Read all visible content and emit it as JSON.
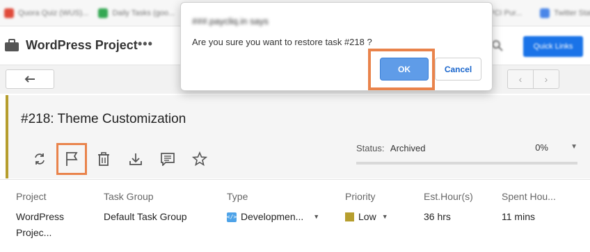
{
  "browser": {
    "bookmarks": [
      {
        "label": "Quora Quiz (WUS)...",
        "color": "#e04a3a"
      },
      {
        "label": "Daily Tasks (goo...",
        "color": "#34a853"
      },
      {
        "label": "",
        "color": "#1a73e8"
      },
      {
        "label": "",
        "color": "#ea4335"
      },
      {
        "label": "",
        "color": "#4285f4"
      },
      {
        "label": "",
        "color": "#fbbc04"
      },
      {
        "label": "PCI Pur...",
        "color": "#8e7cc3"
      },
      {
        "label": "Twitter Stat...",
        "color": "#4a86e8"
      }
    ]
  },
  "header": {
    "project_title": "WordPress Project",
    "more_glyph": "•••",
    "quick_button": "Quick Links"
  },
  "toolbar": {
    "back_glyph": "←",
    "prev_glyph": "‹",
    "next_glyph": "›"
  },
  "task": {
    "title": "#218: Theme Customization",
    "status_label": "Status:",
    "status_value": "Archived",
    "progress": "0%",
    "progress_fraction": 0,
    "accent_color": "#b69e2e",
    "icons": [
      "refresh-icon",
      "flag-icon",
      "trash-icon",
      "download-icon",
      "comment-icon",
      "star-icon"
    ]
  },
  "details": {
    "columns": [
      {
        "header": "Project",
        "value_line1": "WordPress",
        "value_line2": "Projec..."
      },
      {
        "header": "Task Group",
        "value_line1": "Default Task Group"
      },
      {
        "header": "Type",
        "value_line1": "Developmen..."
      },
      {
        "header": "Priority",
        "value_line1": "Low"
      },
      {
        "header": "Est.Hour(s)",
        "value_line1": "36 hrs"
      },
      {
        "header": "Spent Hou...",
        "value_line1": "11 mins"
      }
    ]
  },
  "dialog": {
    "origin": "###.paycliq.in says",
    "message": "Are you sure you want to restore task #218 ?",
    "ok_label": "OK",
    "cancel_label": "Cancel",
    "highlight_color": "#e9834b"
  }
}
